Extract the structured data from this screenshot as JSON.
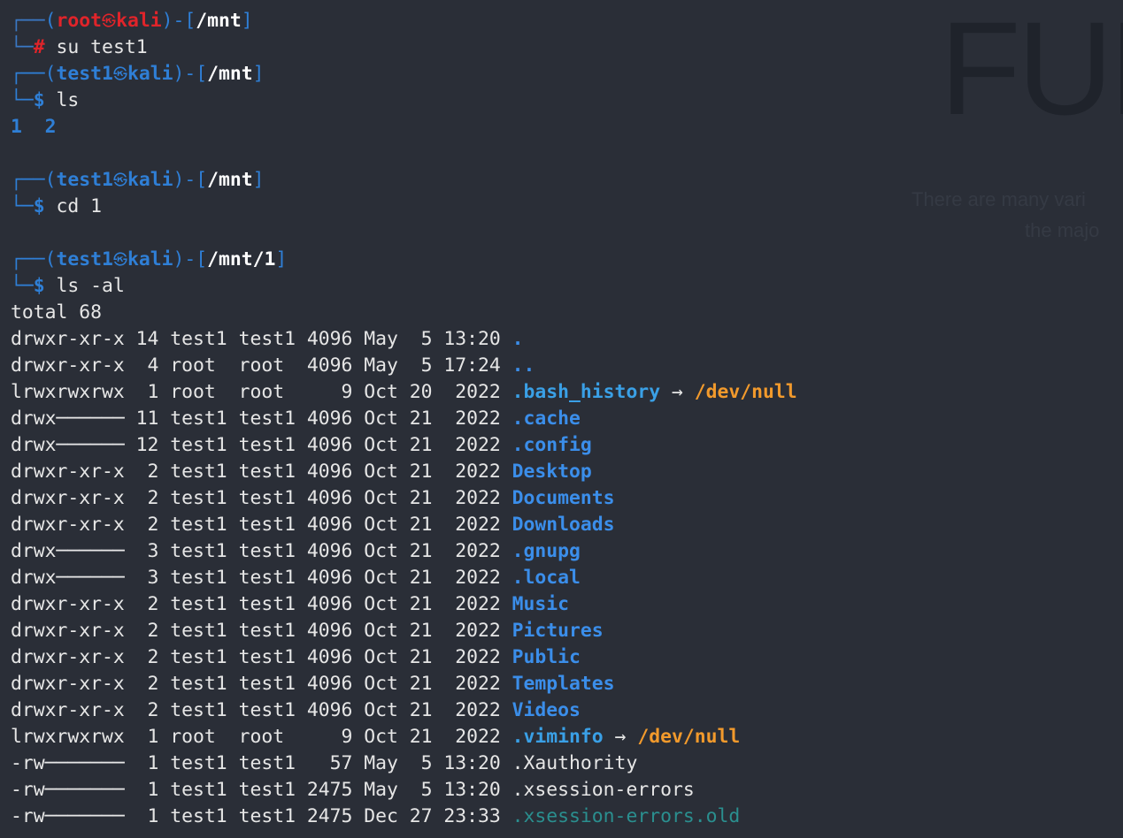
{
  "colors": {
    "background": "#2a2e37",
    "prompt_blue": "#2f7fd6",
    "root_red": "#e0242a",
    "directory": "#3b8eea",
    "symlink_target": "#f29a2c",
    "text": "#e6e6e6"
  },
  "icons": {
    "prompt_at_symbol": "kali-dragon-icon"
  },
  "wallpaper": {
    "heading": "FUR",
    "line1": "There are many vari",
    "line2": "the majo"
  },
  "session": [
    {
      "prompt": {
        "user": "root",
        "host": "kali",
        "path": "/mnt",
        "symbol": "#"
      },
      "command": "su test1",
      "output": []
    },
    {
      "prompt": {
        "user": "test1",
        "host": "kali",
        "path": "/mnt",
        "symbol": "$"
      },
      "command": "ls",
      "output": [
        "1  2",
        ""
      ]
    },
    {
      "prompt": {
        "user": "test1",
        "host": "kali",
        "path": "/mnt",
        "symbol": "$"
      },
      "command": "cd 1",
      "output": [
        ""
      ]
    },
    {
      "prompt": {
        "user": "test1",
        "host": "kali",
        "path": "/mnt/1",
        "symbol": "$"
      },
      "command": "ls -al",
      "output": [
        "total 68"
      ]
    }
  ],
  "listing": [
    {
      "meta": "drwxr-xr-x 14 test1 test1 4096 May  5 13:20 ",
      "name": ".",
      "type": "dir"
    },
    {
      "meta": "drwxr-xr-x  4 root  root  4096 May  5 17:24 ",
      "name": "..",
      "type": "dir"
    },
    {
      "meta": "lrwxrwxrwx  1 root  root     9 Oct 20  2022 ",
      "name": ".bash_history",
      "type": "link",
      "arrow": " → ",
      "target": "/dev/null"
    },
    {
      "meta": "drwx────── 11 test1 test1 4096 Oct 21  2022 ",
      "name": ".cache",
      "type": "dir"
    },
    {
      "meta": "drwx────── 12 test1 test1 4096 Oct 21  2022 ",
      "name": ".config",
      "type": "dir"
    },
    {
      "meta": "drwxr-xr-x  2 test1 test1 4096 Oct 21  2022 ",
      "name": "Desktop",
      "type": "dir"
    },
    {
      "meta": "drwxr-xr-x  2 test1 test1 4096 Oct 21  2022 ",
      "name": "Documents",
      "type": "dir"
    },
    {
      "meta": "drwxr-xr-x  2 test1 test1 4096 Oct 21  2022 ",
      "name": "Downloads",
      "type": "dir"
    },
    {
      "meta": "drwx──────  3 test1 test1 4096 Oct 21  2022 ",
      "name": ".gnupg",
      "type": "dir"
    },
    {
      "meta": "drwx──────  3 test1 test1 4096 Oct 21  2022 ",
      "name": ".local",
      "type": "dir"
    },
    {
      "meta": "drwxr-xr-x  2 test1 test1 4096 Oct 21  2022 ",
      "name": "Music",
      "type": "dir"
    },
    {
      "meta": "drwxr-xr-x  2 test1 test1 4096 Oct 21  2022 ",
      "name": "Pictures",
      "type": "dir"
    },
    {
      "meta": "drwxr-xr-x  2 test1 test1 4096 Oct 21  2022 ",
      "name": "Public",
      "type": "dir"
    },
    {
      "meta": "drwxr-xr-x  2 test1 test1 4096 Oct 21  2022 ",
      "name": "Templates",
      "type": "dir"
    },
    {
      "meta": "drwxr-xr-x  2 test1 test1 4096 Oct 21  2022 ",
      "name": "Videos",
      "type": "dir"
    },
    {
      "meta": "lrwxrwxrwx  1 root  root     9 Oct 21  2022 ",
      "name": ".viminfo",
      "type": "link",
      "arrow": " → ",
      "target": "/dev/null"
    },
    {
      "meta": "-rw───────  1 test1 test1   57 May  5 13:20 ",
      "name": ".Xauthority",
      "type": "file"
    },
    {
      "meta": "-rw───────  1 test1 test1 2475 May  5 13:20 ",
      "name": ".xsession-errors",
      "type": "file"
    },
    {
      "meta": "-rw───────  1 test1 test1 2475 Dec 27 23:33 ",
      "name": ".xsession-errors.old",
      "type": "dim"
    }
  ]
}
